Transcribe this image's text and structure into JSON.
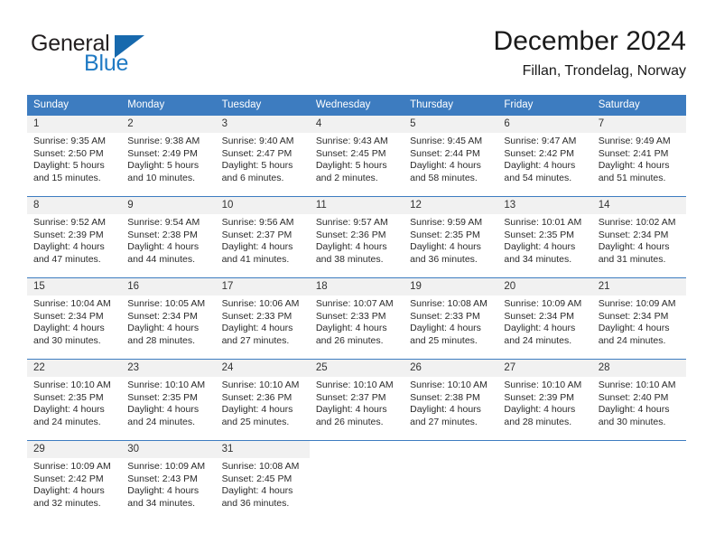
{
  "brand": {
    "name_part1": "General",
    "name_part2": "Blue",
    "triangle_icon": "triangle-logo-icon",
    "color_dark": "#231f20",
    "color_blue": "#1f7ac4"
  },
  "header": {
    "title": "December 2024",
    "subtitle": "Fillan, Trondelag, Norway"
  },
  "theme": {
    "header_blue": "#3d7cc0",
    "daynum_band": "#f1f1f1",
    "text": "#2a2a2a"
  },
  "calendar": {
    "weekday_headers": [
      "Sunday",
      "Monday",
      "Tuesday",
      "Wednesday",
      "Thursday",
      "Friday",
      "Saturday"
    ],
    "weeks": [
      [
        {
          "day": "1",
          "sunrise": "Sunrise: 9:35 AM",
          "sunset": "Sunset: 2:50 PM",
          "daylight1": "Daylight: 5 hours",
          "daylight2": "and 15 minutes."
        },
        {
          "day": "2",
          "sunrise": "Sunrise: 9:38 AM",
          "sunset": "Sunset: 2:49 PM",
          "daylight1": "Daylight: 5 hours",
          "daylight2": "and 10 minutes."
        },
        {
          "day": "3",
          "sunrise": "Sunrise: 9:40 AM",
          "sunset": "Sunset: 2:47 PM",
          "daylight1": "Daylight: 5 hours",
          "daylight2": "and 6 minutes."
        },
        {
          "day": "4",
          "sunrise": "Sunrise: 9:43 AM",
          "sunset": "Sunset: 2:45 PM",
          "daylight1": "Daylight: 5 hours",
          "daylight2": "and 2 minutes."
        },
        {
          "day": "5",
          "sunrise": "Sunrise: 9:45 AM",
          "sunset": "Sunset: 2:44 PM",
          "daylight1": "Daylight: 4 hours",
          "daylight2": "and 58 minutes."
        },
        {
          "day": "6",
          "sunrise": "Sunrise: 9:47 AM",
          "sunset": "Sunset: 2:42 PM",
          "daylight1": "Daylight: 4 hours",
          "daylight2": "and 54 minutes."
        },
        {
          "day": "7",
          "sunrise": "Sunrise: 9:49 AM",
          "sunset": "Sunset: 2:41 PM",
          "daylight1": "Daylight: 4 hours",
          "daylight2": "and 51 minutes."
        }
      ],
      [
        {
          "day": "8",
          "sunrise": "Sunrise: 9:52 AM",
          "sunset": "Sunset: 2:39 PM",
          "daylight1": "Daylight: 4 hours",
          "daylight2": "and 47 minutes."
        },
        {
          "day": "9",
          "sunrise": "Sunrise: 9:54 AM",
          "sunset": "Sunset: 2:38 PM",
          "daylight1": "Daylight: 4 hours",
          "daylight2": "and 44 minutes."
        },
        {
          "day": "10",
          "sunrise": "Sunrise: 9:56 AM",
          "sunset": "Sunset: 2:37 PM",
          "daylight1": "Daylight: 4 hours",
          "daylight2": "and 41 minutes."
        },
        {
          "day": "11",
          "sunrise": "Sunrise: 9:57 AM",
          "sunset": "Sunset: 2:36 PM",
          "daylight1": "Daylight: 4 hours",
          "daylight2": "and 38 minutes."
        },
        {
          "day": "12",
          "sunrise": "Sunrise: 9:59 AM",
          "sunset": "Sunset: 2:35 PM",
          "daylight1": "Daylight: 4 hours",
          "daylight2": "and 36 minutes."
        },
        {
          "day": "13",
          "sunrise": "Sunrise: 10:01 AM",
          "sunset": "Sunset: 2:35 PM",
          "daylight1": "Daylight: 4 hours",
          "daylight2": "and 34 minutes."
        },
        {
          "day": "14",
          "sunrise": "Sunrise: 10:02 AM",
          "sunset": "Sunset: 2:34 PM",
          "daylight1": "Daylight: 4 hours",
          "daylight2": "and 31 minutes."
        }
      ],
      [
        {
          "day": "15",
          "sunrise": "Sunrise: 10:04 AM",
          "sunset": "Sunset: 2:34 PM",
          "daylight1": "Daylight: 4 hours",
          "daylight2": "and 30 minutes."
        },
        {
          "day": "16",
          "sunrise": "Sunrise: 10:05 AM",
          "sunset": "Sunset: 2:34 PM",
          "daylight1": "Daylight: 4 hours",
          "daylight2": "and 28 minutes."
        },
        {
          "day": "17",
          "sunrise": "Sunrise: 10:06 AM",
          "sunset": "Sunset: 2:33 PM",
          "daylight1": "Daylight: 4 hours",
          "daylight2": "and 27 minutes."
        },
        {
          "day": "18",
          "sunrise": "Sunrise: 10:07 AM",
          "sunset": "Sunset: 2:33 PM",
          "daylight1": "Daylight: 4 hours",
          "daylight2": "and 26 minutes."
        },
        {
          "day": "19",
          "sunrise": "Sunrise: 10:08 AM",
          "sunset": "Sunset: 2:33 PM",
          "daylight1": "Daylight: 4 hours",
          "daylight2": "and 25 minutes."
        },
        {
          "day": "20",
          "sunrise": "Sunrise: 10:09 AM",
          "sunset": "Sunset: 2:34 PM",
          "daylight1": "Daylight: 4 hours",
          "daylight2": "and 24 minutes."
        },
        {
          "day": "21",
          "sunrise": "Sunrise: 10:09 AM",
          "sunset": "Sunset: 2:34 PM",
          "daylight1": "Daylight: 4 hours",
          "daylight2": "and 24 minutes."
        }
      ],
      [
        {
          "day": "22",
          "sunrise": "Sunrise: 10:10 AM",
          "sunset": "Sunset: 2:35 PM",
          "daylight1": "Daylight: 4 hours",
          "daylight2": "and 24 minutes."
        },
        {
          "day": "23",
          "sunrise": "Sunrise: 10:10 AM",
          "sunset": "Sunset: 2:35 PM",
          "daylight1": "Daylight: 4 hours",
          "daylight2": "and 24 minutes."
        },
        {
          "day": "24",
          "sunrise": "Sunrise: 10:10 AM",
          "sunset": "Sunset: 2:36 PM",
          "daylight1": "Daylight: 4 hours",
          "daylight2": "and 25 minutes."
        },
        {
          "day": "25",
          "sunrise": "Sunrise: 10:10 AM",
          "sunset": "Sunset: 2:37 PM",
          "daylight1": "Daylight: 4 hours",
          "daylight2": "and 26 minutes."
        },
        {
          "day": "26",
          "sunrise": "Sunrise: 10:10 AM",
          "sunset": "Sunset: 2:38 PM",
          "daylight1": "Daylight: 4 hours",
          "daylight2": "and 27 minutes."
        },
        {
          "day": "27",
          "sunrise": "Sunrise: 10:10 AM",
          "sunset": "Sunset: 2:39 PM",
          "daylight1": "Daylight: 4 hours",
          "daylight2": "and 28 minutes."
        },
        {
          "day": "28",
          "sunrise": "Sunrise: 10:10 AM",
          "sunset": "Sunset: 2:40 PM",
          "daylight1": "Daylight: 4 hours",
          "daylight2": "and 30 minutes."
        }
      ],
      [
        {
          "day": "29",
          "sunrise": "Sunrise: 10:09 AM",
          "sunset": "Sunset: 2:42 PM",
          "daylight1": "Daylight: 4 hours",
          "daylight2": "and 32 minutes."
        },
        {
          "day": "30",
          "sunrise": "Sunrise: 10:09 AM",
          "sunset": "Sunset: 2:43 PM",
          "daylight1": "Daylight: 4 hours",
          "daylight2": "and 34 minutes."
        },
        {
          "day": "31",
          "sunrise": "Sunrise: 10:08 AM",
          "sunset": "Sunset: 2:45 PM",
          "daylight1": "Daylight: 4 hours",
          "daylight2": "and 36 minutes."
        },
        {
          "day": "",
          "sunrise": "",
          "sunset": "",
          "daylight1": "",
          "daylight2": ""
        },
        {
          "day": "",
          "sunrise": "",
          "sunset": "",
          "daylight1": "",
          "daylight2": ""
        },
        {
          "day": "",
          "sunrise": "",
          "sunset": "",
          "daylight1": "",
          "daylight2": ""
        },
        {
          "day": "",
          "sunrise": "",
          "sunset": "",
          "daylight1": "",
          "daylight2": ""
        }
      ]
    ]
  }
}
